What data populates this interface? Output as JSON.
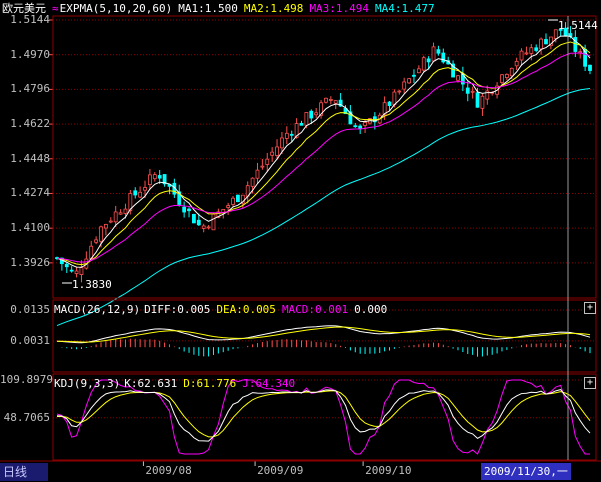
{
  "symbol": "欧元美元",
  "timeframe_tab": "日线",
  "cursor_date": "2009/11/30,一",
  "colors": {
    "up": "#ff5050",
    "down": "#00ffff",
    "ma1": "#ffffff",
    "ma2": "#ffff00",
    "ma3": "#ff00ff",
    "ma4": "#00ffff",
    "grid": "#8b0000",
    "axis": "#c0c0c0"
  },
  "price_panel": {
    "indicator": "EXPMA(5,10,20,60)",
    "ma1": {
      "label": "MA1:1.500"
    },
    "ma2": {
      "label": "MA2:1.498"
    },
    "ma3": {
      "label": "MA3:1.494"
    },
    "ma4": {
      "label": "MA4:1.477"
    },
    "ticks": [
      "1.5144",
      "1.4970",
      "1.4796",
      "1.4622",
      "1.4448",
      "1.4274",
      "1.4100",
      "1.3926"
    ],
    "high_marker": "1.5144",
    "low_marker": "1.3830"
  },
  "macd_panel": {
    "indicator": "MACD(26,12,9)",
    "diff_label": "DIFF:0.005",
    "dea_label": "DEA:0.005",
    "macd_label": "MACD:0.001",
    "extra_label": "0.000",
    "ticks": [
      "0.0135",
      "0.0031"
    ]
  },
  "kdj_panel": {
    "indicator": "KDJ(9,3,3)",
    "k_label": "K:62.631",
    "d_label": "D:61.776",
    "j_label": "J:64.340",
    "ticks": [
      "109.8979",
      "48.7065"
    ]
  },
  "x_labels": [
    "2009/08",
    "2009/09",
    "2009/10"
  ],
  "plus_symbol": "+",
  "chart_data": [
    {
      "type": "candlestick",
      "title": "",
      "x": [
        "2009-07",
        "2009-08",
        "2009-09",
        "2009-10",
        "2009-11"
      ],
      "ylim": [
        1.383,
        1.5144
      ],
      "x_anchors": [
        {
          "date": "2009-07-08",
          "close": 1.395
        },
        {
          "date": "2009-07-13",
          "close": 1.386
        },
        {
          "date": "2009-07-20",
          "close": 1.41
        },
        {
          "date": "2009-08-05",
          "close": 1.438
        },
        {
          "date": "2009-08-17",
          "close": 1.41
        },
        {
          "date": "2009-08-28",
          "close": 1.427
        },
        {
          "date": "2009-09-10",
          "close": 1.458
        },
        {
          "date": "2009-09-23",
          "close": 1.476
        },
        {
          "date": "2009-09-30",
          "close": 1.458
        },
        {
          "date": "2009-10-09",
          "close": 1.474
        },
        {
          "date": "2009-10-21",
          "close": 1.5
        },
        {
          "date": "2009-11-02",
          "close": 1.473
        },
        {
          "date": "2009-11-12",
          "close": 1.494
        },
        {
          "date": "2009-11-25",
          "close": 1.51
        },
        {
          "date": "2009-11-30",
          "close": 1.497
        },
        {
          "date": "2009-12-03",
          "close": 1.49
        }
      ],
      "series": [
        {
          "name": "MA1",
          "values": [
            1.5
          ]
        },
        {
          "name": "MA2",
          "values": [
            1.498
          ]
        },
        {
          "name": "MA3",
          "values": [
            1.494
          ]
        },
        {
          "name": "MA4",
          "values": [
            1.477
          ]
        }
      ]
    },
    {
      "type": "bar",
      "title": "",
      "series": [
        {
          "name": "DIFF",
          "values": [
            0.005
          ]
        },
        {
          "name": "DEA",
          "values": [
            0.005
          ]
        },
        {
          "name": "MACD",
          "values": [
            0.001
          ]
        }
      ]
    },
    {
      "type": "line",
      "title": "",
      "series": [
        {
          "name": "K",
          "values": [
            62.631
          ]
        },
        {
          "name": "D",
          "values": [
            61.776
          ]
        },
        {
          "name": "J",
          "values": [
            64.34
          ]
        }
      ]
    }
  ]
}
